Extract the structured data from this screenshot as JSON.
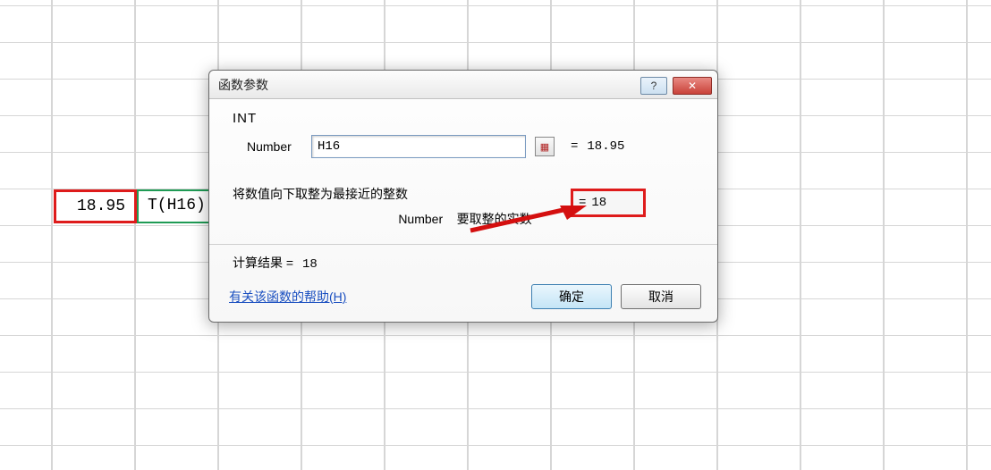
{
  "grid": {
    "cell_a_value": "18.95",
    "cell_b_value": "T(H16)"
  },
  "dialog": {
    "title": "函数参数",
    "help_button": "?",
    "close_button": "✕",
    "function_name": "INT",
    "arg": {
      "label": "Number",
      "value": "H16",
      "evaluated": "18.95"
    },
    "eq_sign": "=",
    "callout_result": "18",
    "description": "将数值向下取整为最接近的整数",
    "arg_description_label": "Number",
    "arg_description_text": "要取整的实数",
    "calc_result_label": "计算结果 =",
    "calc_result_value": "18",
    "help_link": "有关该函数的帮助(H)",
    "ok": "确定",
    "cancel": "取消"
  }
}
